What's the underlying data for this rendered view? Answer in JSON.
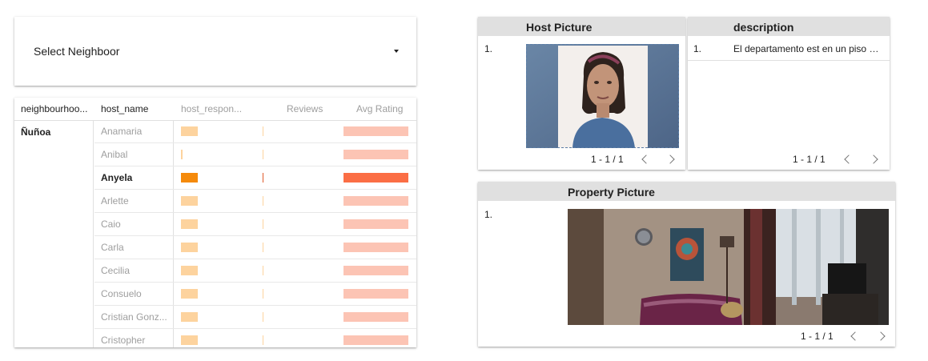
{
  "dropdown": {
    "label": "Select Neighboor"
  },
  "pivot": {
    "headers": [
      "neighbourhoo...",
      "host_name",
      "host_respon...",
      "Reviews",
      "Avg Rating"
    ],
    "neighbourhood": "Ñuñoa",
    "rows": [
      {
        "name": "Anamaria",
        "response_rate": 0.26,
        "selected": false
      },
      {
        "name": "Anibal",
        "response_rate": 0.02,
        "selected": false
      },
      {
        "name": "Anyela",
        "response_rate": 0.26,
        "selected": true
      },
      {
        "name": "Arlette",
        "response_rate": 0.26,
        "selected": false
      },
      {
        "name": "Caio",
        "response_rate": 0.26,
        "selected": false
      },
      {
        "name": "Carla",
        "response_rate": 0.26,
        "selected": false
      },
      {
        "name": "Cecilia",
        "response_rate": 0.26,
        "selected": false
      },
      {
        "name": "Consuelo",
        "response_rate": 0.26,
        "selected": false
      },
      {
        "name": "Cristian Gonz...",
        "response_rate": 0.26,
        "selected": false
      },
      {
        "name": "Cristopher",
        "response_rate": 0.26,
        "selected": false
      }
    ]
  },
  "host_table": {
    "header": "Host Picture",
    "row_number": "1.",
    "pager": "1 - 1 / 1"
  },
  "desc_table": {
    "header": "description",
    "row_number": "1.",
    "text": "El departamento est en un piso 1...",
    "pager": "1 - 1 / 1"
  },
  "prop_table": {
    "header": "Property Picture",
    "row_number": "1.",
    "pager": "1 - 1 / 1"
  },
  "colors": {
    "header_bg": "#e0e0e0",
    "bar_light": "#fdd39e",
    "bar_dark": "#f58a0b",
    "rating_light": "#fcc4b4",
    "rating_dark": "#fb6e45"
  }
}
